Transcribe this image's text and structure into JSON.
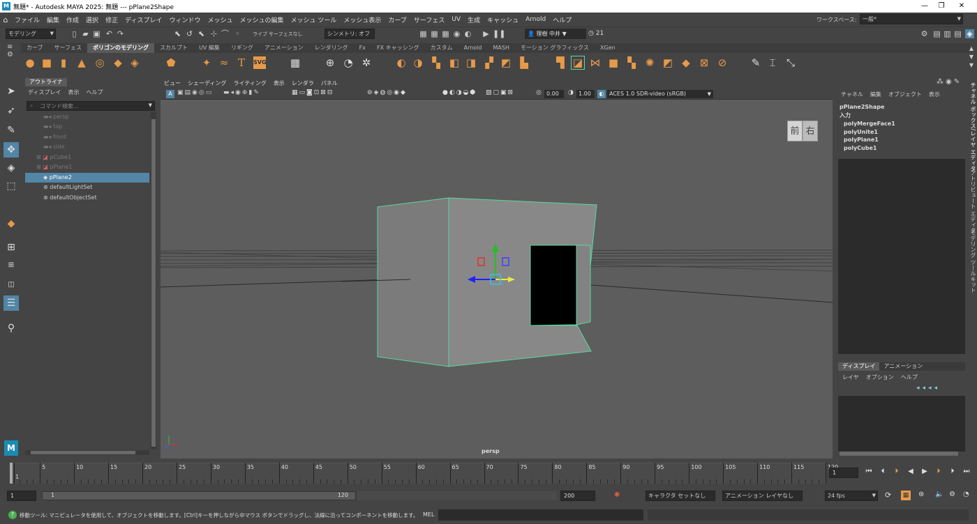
{
  "window": {
    "title": "無題* - Autodesk MAYA 2025: 無題   ---   pPlane2Shape",
    "min": "—",
    "max": "❐",
    "close": "✕"
  },
  "menu": [
    "ファイル",
    "編集",
    "作成",
    "選択",
    "修正",
    "ディスプレイ",
    "ウィンドウ",
    "メッシュ",
    "メッシュの編集",
    "メッシュ ツール",
    "メッシュ表示",
    "カーブ",
    "サーフェス",
    "UV",
    "生成",
    "キャッシュ",
    "Arnold",
    "ヘルプ"
  ],
  "workspace": {
    "label": "ワークスペース:",
    "value": "一般*"
  },
  "statusline": {
    "mode": "モデリング",
    "live": "ライブ",
    "surface": "サーフェスなし",
    "symmetry": "シンメトリ: オフ",
    "user": "理樹 中井",
    "notifications": "21"
  },
  "shelf_tabs": [
    "カーブ",
    "サーフェス",
    "ポリゴンのモデリング",
    "スカルプト",
    "UV 編集",
    "リギング",
    "アニメーション",
    "レンダリング",
    "Fx",
    "FX キャッシング",
    "カスタム",
    "Arnold",
    "MASH",
    "モーション グラフィックス",
    "XGen"
  ],
  "shelf_active": "ポリゴンのモデリング",
  "outliner": {
    "tab": "アウトライナ",
    "menu": [
      "ディスプレイ",
      "表示",
      "ヘルプ"
    ],
    "search": "コマンド検索...",
    "items": [
      "persp",
      "top",
      "front",
      "side",
      "pCube1",
      "pPlane1",
      "pPlane2",
      "defaultLightSet",
      "defaultObjectSet"
    ],
    "selected": "pPlane2"
  },
  "viewport": {
    "menu": [
      "ビュー",
      "シェーディング",
      "ライティング",
      "表示",
      "レンダラ",
      "パネル"
    ],
    "exposure": "0.00",
    "gamma": "1.00",
    "colorspace": "ACES 1.0 SDR-video (sRGB)",
    "camera": "persp",
    "viewcube_front": "前",
    "viewcube_right": "右"
  },
  "channelbox": {
    "menu": [
      "チャネル",
      "編集",
      "オブジェクト",
      "表示"
    ],
    "shape": "pPlane2Shape",
    "inputs_label": "入力",
    "inputs": [
      "polyMergeFace1",
      "polyUnite1",
      "polyPlane1",
      "polyCube1"
    ],
    "layer_tabs": [
      "ディスプレイ",
      "アニメーション"
    ],
    "layer_menu": [
      "レイヤ",
      "オプション",
      "ヘルプ"
    ]
  },
  "side_tabs": [
    "チャネル ボックス/レイヤ エディタ",
    "アトリビュート エディタ",
    "モデリング ツールキット"
  ],
  "timeline": {
    "ticks": [
      "1",
      "5",
      "10",
      "15",
      "20",
      "25",
      "30",
      "35",
      "40",
      "45",
      "50",
      "55",
      "60",
      "65",
      "70",
      "75",
      "80",
      "85",
      "90",
      "95",
      "100",
      "105",
      "110",
      "115",
      "120"
    ],
    "current": "1"
  },
  "range": {
    "start": "1",
    "inner_start": "1",
    "inner_end": "120",
    "end": "200",
    "character": "キャラクタ セットなし",
    "anim_layer": "アニメーション レイヤなし",
    "fps": "24 fps"
  },
  "help": {
    "text": "移動ツール: マニピュレータを使用して、オブジェクトを移動します。[Ctrl]キーを押しながら中マウス ボタンでドラッグし、法線に沿ってコンポーネントを移動します。[Shift]キーを押しながらマニピ",
    "mel": "MEL"
  }
}
